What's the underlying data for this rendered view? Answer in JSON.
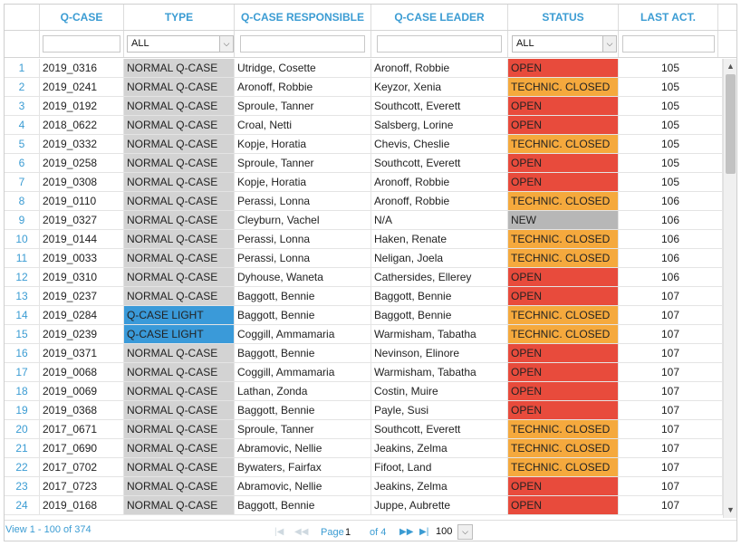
{
  "columns": {
    "qcase": "Q-CASE",
    "type": "TYPE",
    "responsible": "Q-CASE RESPONSIBLE",
    "leader": "Q-CASE LEADER",
    "status": "STATUS",
    "last_act": "LAST ACT."
  },
  "filters": {
    "type_selected": "ALL",
    "status_selected": "ALL"
  },
  "rows": [
    {
      "n": "1",
      "qcase": "2019_0316",
      "type": "NORMAL Q-CASE",
      "resp": "Utridge, Cosette",
      "leader": "Aronoff, Robbie",
      "status": "OPEN",
      "last": "105"
    },
    {
      "n": "2",
      "qcase": "2019_0241",
      "type": "NORMAL Q-CASE",
      "resp": "Aronoff, Robbie",
      "leader": "Keyzor, Xenia",
      "status": "TECHNIC. CLOSED",
      "last": "105"
    },
    {
      "n": "3",
      "qcase": "2019_0192",
      "type": "NORMAL Q-CASE",
      "resp": "Sproule, Tanner",
      "leader": "Southcott, Everett",
      "status": "OPEN",
      "last": "105"
    },
    {
      "n": "4",
      "qcase": "2018_0622",
      "type": "NORMAL Q-CASE",
      "resp": "Croal, Netti",
      "leader": "Salsberg, Lorine",
      "status": "OPEN",
      "last": "105"
    },
    {
      "n": "5",
      "qcase": "2019_0332",
      "type": "NORMAL Q-CASE",
      "resp": "Kopje, Horatia",
      "leader": "Chevis, Cheslie",
      "status": "TECHNIC. CLOSED",
      "last": "105"
    },
    {
      "n": "6",
      "qcase": "2019_0258",
      "type": "NORMAL Q-CASE",
      "resp": "Sproule, Tanner",
      "leader": "Southcott, Everett",
      "status": "OPEN",
      "last": "105"
    },
    {
      "n": "7",
      "qcase": "2019_0308",
      "type": "NORMAL Q-CASE",
      "resp": "Kopje, Horatia",
      "leader": "Aronoff, Robbie",
      "status": "OPEN",
      "last": "105"
    },
    {
      "n": "8",
      "qcase": "2019_0110",
      "type": "NORMAL Q-CASE",
      "resp": "Perassi, Lonna",
      "leader": "Aronoff, Robbie",
      "status": "TECHNIC. CLOSED",
      "last": "106"
    },
    {
      "n": "9",
      "qcase": "2019_0327",
      "type": "NORMAL Q-CASE",
      "resp": "Cleyburn, Vachel",
      "leader": "N/A",
      "status": "NEW",
      "last": "106"
    },
    {
      "n": "10",
      "qcase": "2019_0144",
      "type": "NORMAL Q-CASE",
      "resp": "Perassi, Lonna",
      "leader": "Haken, Renate",
      "status": "TECHNIC. CLOSED",
      "last": "106"
    },
    {
      "n": "11",
      "qcase": "2019_0033",
      "type": "NORMAL Q-CASE",
      "resp": "Perassi, Lonna",
      "leader": "Neligan, Joela",
      "status": "TECHNIC. CLOSED",
      "last": "106"
    },
    {
      "n": "12",
      "qcase": "2019_0310",
      "type": "NORMAL Q-CASE",
      "resp": "Dyhouse, Waneta",
      "leader": "Cathersides, Ellerey",
      "status": "OPEN",
      "last": "106"
    },
    {
      "n": "13",
      "qcase": "2019_0237",
      "type": "NORMAL Q-CASE",
      "resp": "Baggott, Bennie",
      "leader": "Baggott, Bennie",
      "status": "OPEN",
      "last": "107"
    },
    {
      "n": "14",
      "qcase": "2019_0284",
      "type": "Q-CASE LIGHT",
      "resp": "Baggott, Bennie",
      "leader": "Baggott, Bennie",
      "status": "TECHNIC. CLOSED",
      "last": "107"
    },
    {
      "n": "15",
      "qcase": "2019_0239",
      "type": "Q-CASE LIGHT",
      "resp": "Coggill, Ammamaria",
      "leader": "Warmisham, Tabatha",
      "status": "TECHNIC. CLOSED",
      "last": "107"
    },
    {
      "n": "16",
      "qcase": "2019_0371",
      "type": "NORMAL Q-CASE",
      "resp": "Baggott, Bennie",
      "leader": "Nevinson, Elinore",
      "status": "OPEN",
      "last": "107"
    },
    {
      "n": "17",
      "qcase": "2019_0068",
      "type": "NORMAL Q-CASE",
      "resp": "Coggill, Ammamaria",
      "leader": "Warmisham, Tabatha",
      "status": "OPEN",
      "last": "107"
    },
    {
      "n": "18",
      "qcase": "2019_0069",
      "type": "NORMAL Q-CASE",
      "resp": "Lathan, Zonda",
      "leader": "Costin, Muire",
      "status": "OPEN",
      "last": "107"
    },
    {
      "n": "19",
      "qcase": "2019_0368",
      "type": "NORMAL Q-CASE",
      "resp": "Baggott, Bennie",
      "leader": "Payle, Susi",
      "status": "OPEN",
      "last": "107"
    },
    {
      "n": "20",
      "qcase": "2017_0671",
      "type": "NORMAL Q-CASE",
      "resp": "Sproule, Tanner",
      "leader": "Southcott, Everett",
      "status": "TECHNIC. CLOSED",
      "last": "107"
    },
    {
      "n": "21",
      "qcase": "2017_0690",
      "type": "NORMAL Q-CASE",
      "resp": "Abramovic, Nellie",
      "leader": "Jeakins, Zelma",
      "status": "TECHNIC. CLOSED",
      "last": "107"
    },
    {
      "n": "22",
      "qcase": "2017_0702",
      "type": "NORMAL Q-CASE",
      "resp": "Bywaters, Fairfax",
      "leader": "Fifoot, Land",
      "status": "TECHNIC. CLOSED",
      "last": "107"
    },
    {
      "n": "23",
      "qcase": "2017_0723",
      "type": "NORMAL Q-CASE",
      "resp": "Abramovic, Nellie",
      "leader": "Jeakins, Zelma",
      "status": "OPEN",
      "last": "107"
    },
    {
      "n": "24",
      "qcase": "2019_0168",
      "type": "NORMAL Q-CASE",
      "resp": "Baggott, Bennie",
      "leader": "Juppe, Aubrette",
      "status": "OPEN",
      "last": "107"
    }
  ],
  "pager": {
    "info": "View 1 - 100 of 374",
    "page_label": "Page",
    "page_value": "1",
    "of_label": "of 4",
    "page_size": "100"
  },
  "colors": {
    "header_text": "#3b9cd3",
    "open": "#e84b3c",
    "technic_closed": "#f5a93d",
    "new": "#b7b7b7",
    "normal_type": "#d3d3d3",
    "light_type": "#3a9ad9"
  },
  "icons": {
    "scroll_up": "chevron-up-icon",
    "scroll_down": "chevron-down-icon",
    "next_page": "next-page-icon",
    "last_page": "last-page-icon",
    "first_page": "first-page-icon",
    "prev_page": "prev-page-icon"
  }
}
